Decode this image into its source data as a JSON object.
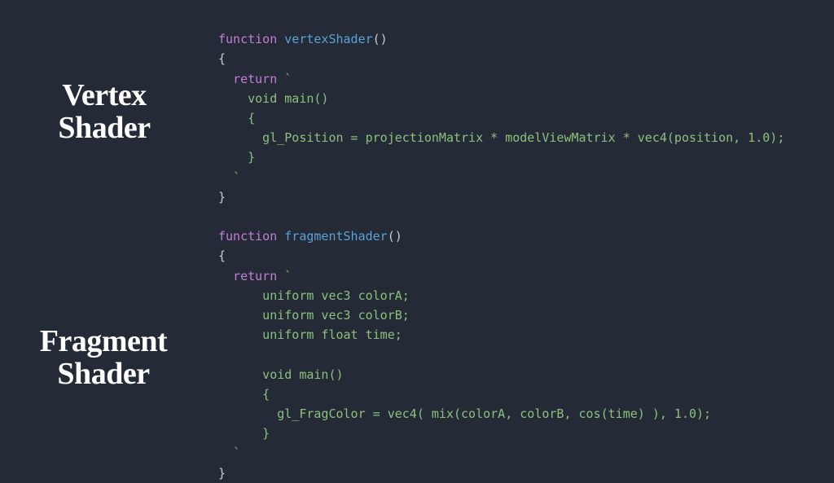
{
  "labels": {
    "vertex_line1": "Vertex",
    "vertex_line2": "Shader",
    "fragment_line1": "Fragment",
    "fragment_line2": "Shader"
  },
  "code": {
    "kw_function": "function",
    "kw_return": "return",
    "fn_vertex": "vertexShader",
    "fn_fragment": "fragmentShader",
    "paren_pair": "()",
    "brace_open": "{",
    "brace_close": "}",
    "backtick": "`",
    "vertex_body_l1": "    void main()",
    "vertex_body_l2": "    {",
    "vertex_body_l3": "      gl_Position = projectionMatrix * modelViewMatrix * vec4(position, 1.0);",
    "vertex_body_l4": "    }",
    "vertex_body_l5": "  ",
    "fragment_body_l1": "      uniform vec3 colorA;",
    "fragment_body_l2": "      uniform vec3 colorB;",
    "fragment_body_l3": "      uniform float time;",
    "fragment_body_l4": "",
    "fragment_body_l5": "      void main()",
    "fragment_body_l6": "      {",
    "fragment_body_l7": "        gl_FragColor = vec4( mix(colorA, colorB, cos(time) ), 1.0);",
    "fragment_body_l8": "      }",
    "fragment_body_l9": "  "
  }
}
